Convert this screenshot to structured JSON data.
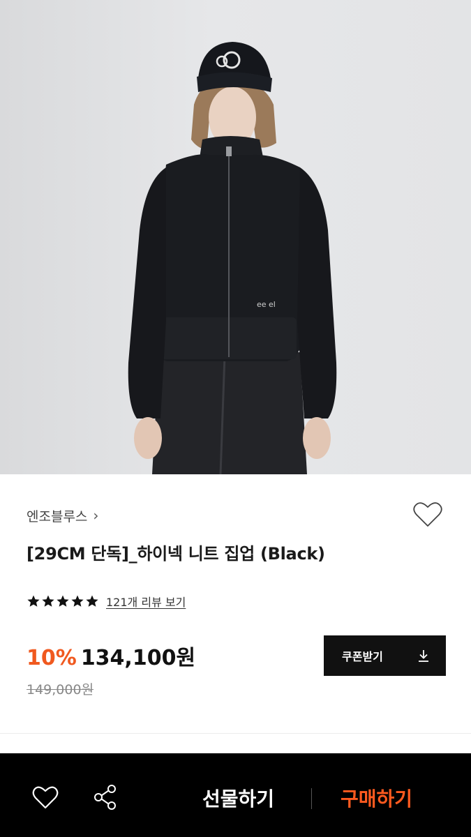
{
  "product": {
    "brand": "엔조블루스",
    "brand_chevron": "›",
    "title": "[29CM 단독]_하이넥 니트 집업 (Black)",
    "rating_stars": 5,
    "review_link": "121개 리뷰 보기",
    "discount": "10%",
    "sale_price": "134,100원",
    "original_price": "149,000원"
  },
  "coupon": {
    "label": "쿠폰받기",
    "icon": "download-icon"
  },
  "bottom_bar": {
    "gift_label": "선물하기",
    "buy_label": "구매하기",
    "icons": [
      "heart-icon",
      "share-icon"
    ]
  },
  "colors": {
    "accent": "#f0591f",
    "buy": "#ff5a1f",
    "bar": "#000000",
    "button": "#111111"
  }
}
